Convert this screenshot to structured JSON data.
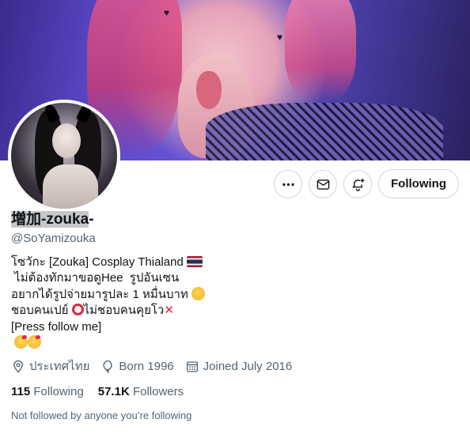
{
  "profile": {
    "display_name_hl": "増加-zouka",
    "display_name_rest": "-",
    "handle": "@SoYamizouka",
    "bio": {
      "line1": "โซวักะ [Zouka] Cosplay Thialand",
      "line2": " ไม่ต้องทักมาขอดูHee  รูปอันเซน",
      "line3": "อยากได้รูปจ่ายมารูปละ 1 หมื่นบาท",
      "line4": "ชอบคนเปย์",
      "line4b": "ไม่ชอบคนคุยโว",
      "line5": "[Press follow me]"
    },
    "location": "ประเทศไทย",
    "born": "Born 1996",
    "joined": "Joined July 2016",
    "following_count": "115",
    "following_label": "Following",
    "followers_count": "57.1K",
    "followers_label": "Followers",
    "followed_by_note": "Not followed by anyone you’re following"
  },
  "actions": {
    "more_icon": "more-horizontal-icon",
    "message_icon": "envelope-icon",
    "notify_icon": "bell-plus-icon",
    "follow_label": "Following"
  },
  "icons": {
    "location": "location-pin-icon",
    "born": "balloon-icon",
    "joined": "calendar-icon"
  },
  "colors": {
    "text_primary": "#0f1419",
    "text_secondary": "#536471",
    "border": "#cfd9de"
  }
}
